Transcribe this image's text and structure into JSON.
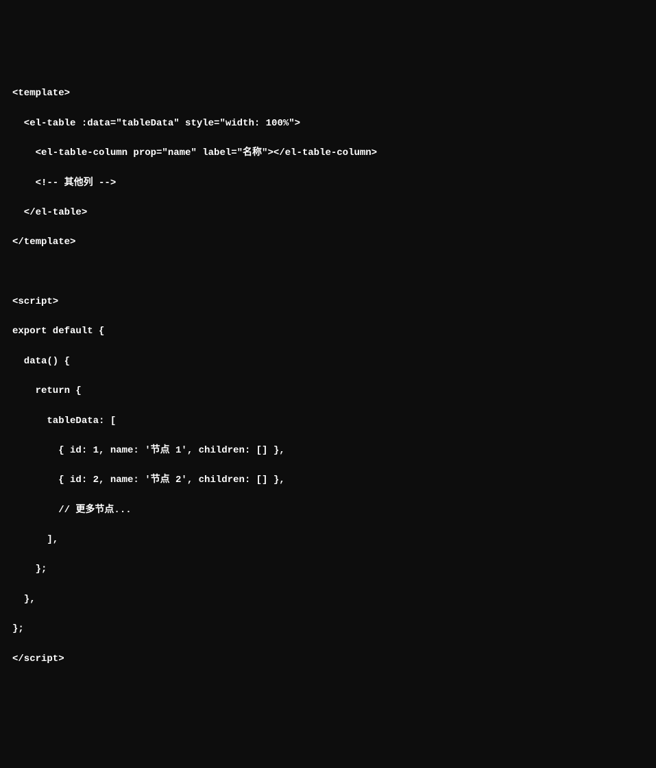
{
  "code": {
    "lines": [
      "<template>",
      "  <el-table :data=\"tableData\" style=\"width: 100%\">",
      "    <el-table-column prop=\"name\" label=\"名称\"></el-table-column>",
      "    <!-- 其他列 -->",
      "  </el-table>",
      "</template>",
      "",
      "<script>",
      "export default {",
      "  data() {",
      "    return {",
      "      tableData: [",
      "        { id: 1, name: '节点 1', children: [] },",
      "        { id: 2, name: '节点 2', children: [] },",
      "        // 更多节点...",
      "      ],",
      "    };",
      "  },",
      "};",
      "</script>"
    ]
  }
}
